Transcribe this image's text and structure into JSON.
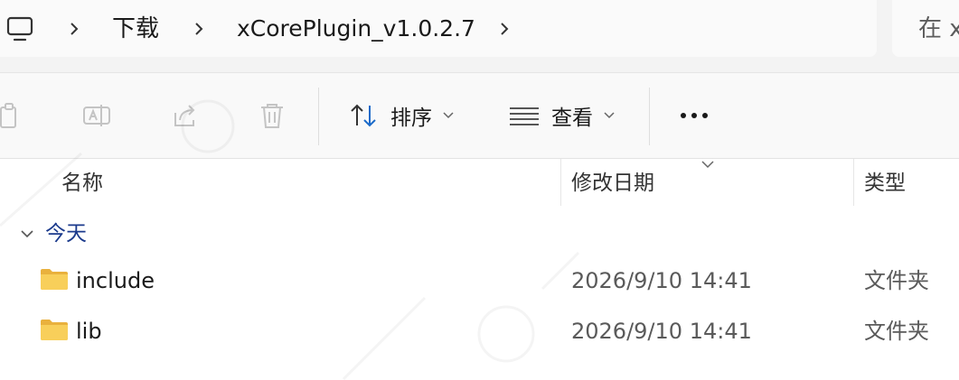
{
  "address_bar": {
    "breadcrumbs": [
      "下载",
      "xCorePlugin_v1.0.2.7"
    ],
    "search_placeholder": "在 x"
  },
  "toolbar": {
    "sort_label": "排序",
    "view_label": "查看"
  },
  "columns": {
    "name": "名称",
    "date_modified": "修改日期",
    "type": "类型"
  },
  "group": {
    "label": "今天"
  },
  "files": [
    {
      "name": "include",
      "date": "2026/9/10 14:41",
      "type": "文件夹"
    },
    {
      "name": "lib",
      "date": "2026/9/10 14:41",
      "type": "文件夹"
    }
  ],
  "icons": {
    "this_pc": "monitor-icon",
    "copy": "copy-icon",
    "rename": "rename-icon",
    "share": "share-icon",
    "delete": "trash-icon",
    "sort": "sort-arrows-icon",
    "view": "view-lines-icon",
    "more": "more-dots-icon",
    "folder": "folder-icon"
  },
  "colors": {
    "accent": "#1b6ac9",
    "group_label": "#1b3a8c",
    "folder_yellow": "#f8cf5a"
  }
}
